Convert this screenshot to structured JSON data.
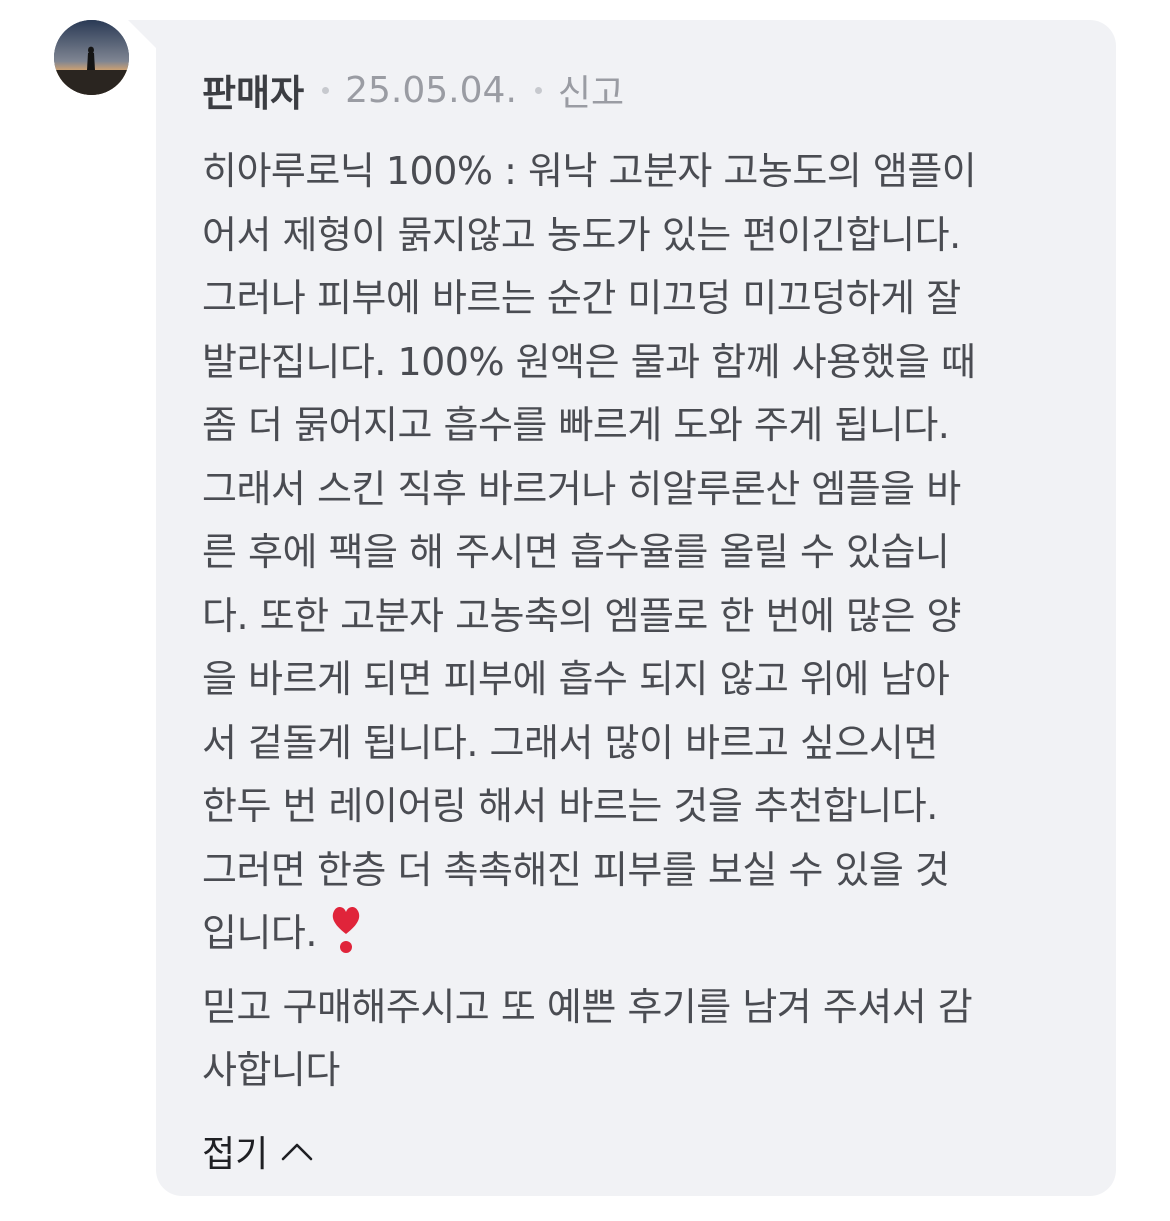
{
  "reply": {
    "author": "판매자",
    "date": "25.05.04.",
    "report_label": "신고",
    "lines_before_heart": "히아루로닉 100% : 워낙 고분자 고농도의 앰플이\n어서 제형이 묽지않고 농도가 있는 편이긴합니다.\n그러나 피부에 바르는 순간 미끄덩 미끄덩하게 잘\n발라집니다. 100% 원액은 물과 함께 사용했을 때\n좀 더 묽어지고 흡수를 빠르게 도와 주게 됩니다.\n그래서 스킨 직후 바르거나 히알루론산 엠플을 바\n른 후에 팩을 해 주시면 흡수율를 올릴 수 있습니\n다. 또한 고분자 고농축의 엠플로 한 번에 많은 양\n을 바르게 되면 피부에 흡수 되지 않고 위에 남아\n서 겉돌게 됩니다. 그래서 많이 바르고 싶으시면\n한두 번 레이어링 해서 바르는 것을 추천합니다.\n그러면 한층 더 촉촉해진 피부를 보실 수 있을 것",
    "heart_line": "입니다.",
    "lines_after_heart": "믿고 구매해주시고 또 예쁜 후기를 남겨 주셔서 감\n사합니다",
    "fold_label": "접기"
  },
  "icons": {
    "heart": "heavy-heart-exclamation-icon",
    "fold": "chevron-up-icon"
  },
  "colors": {
    "bubble_bg": "#f1f2f5",
    "text": "#4a4c52",
    "meta": "#9a9ca3",
    "heart": "#e0243a"
  }
}
